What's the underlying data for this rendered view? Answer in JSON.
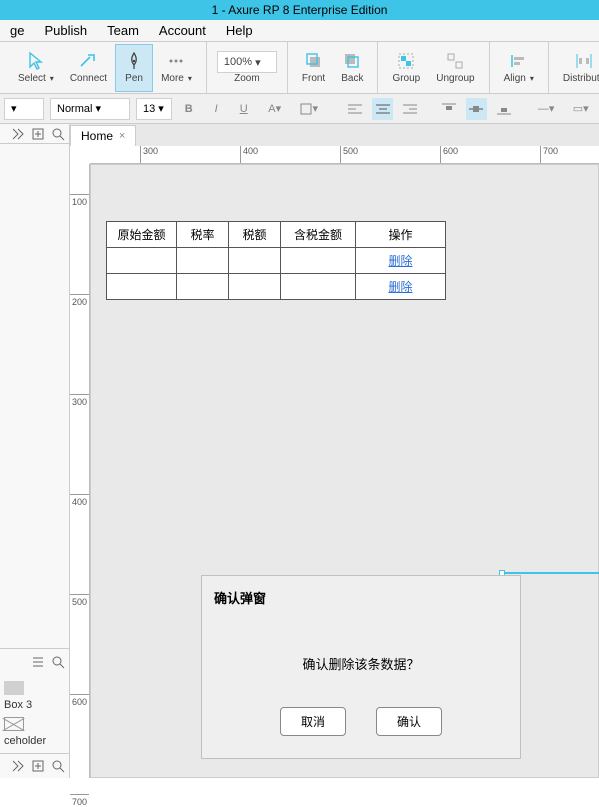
{
  "title": "1 - Axure RP 8 Enterprise Edition",
  "menu": [
    "ge",
    "Publish",
    "Team",
    "Account",
    "Help"
  ],
  "tools": {
    "select": "Select",
    "connect": "Connect",
    "pen": "Pen",
    "more": "More",
    "zoom": "Zoom",
    "zoom_value": "100%",
    "front": "Front",
    "back": "Back",
    "group": "Group",
    "ungroup": "Ungroup",
    "align": "Align",
    "distribute": "Distribute"
  },
  "format_bar": {
    "style": "Normal",
    "font_size": "13"
  },
  "tab": {
    "label": "Home"
  },
  "ruler_h": [
    300,
    400,
    500,
    600,
    700
  ],
  "ruler_v": [
    100,
    200,
    300,
    400,
    500,
    600,
    700
  ],
  "table": {
    "widths": [
      70,
      52,
      52,
      75,
      90
    ],
    "headers": [
      "原始金额",
      "税率",
      "税额",
      "含税金额",
      "操作"
    ],
    "action_label": "删除"
  },
  "left_panel": {
    "item1": "Box 3",
    "item2": "ceholder"
  },
  "dialog": {
    "title": "确认弹窗",
    "message": "确认删除该条数据？",
    "cancel": "取消",
    "confirm": "确认"
  }
}
